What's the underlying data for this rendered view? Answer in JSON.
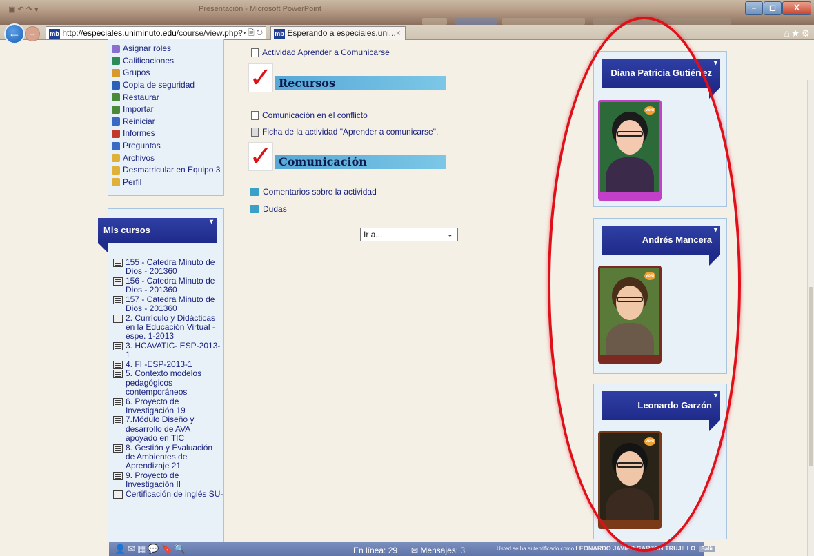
{
  "browser": {
    "window_title_faint": "Presentación - Microsoft PowerPoint",
    "address": "http://especiales.uniminuto.edu/course/view.php?",
    "address_domain": "especiales.uniminuto.edu",
    "address_prefix": "http://",
    "address_suffix": "/course/view.php?",
    "address_icons": "⌕ ▾ 🖹 ↻",
    "tab_title": "Esperando a especiales.uni...",
    "tab_close": "×",
    "back_glyph": "←",
    "forward_glyph": "→",
    "favicon_text": "mb",
    "right_icons": "⌂★⚙",
    "window_buttons": {
      "minimize": "–",
      "maximize": "◻",
      "close": "X"
    }
  },
  "admin_menu": {
    "items": [
      {
        "label": "Asignar roles",
        "icon": "roles-icon",
        "color": "#8a6fd0"
      },
      {
        "label": "Calificaciones",
        "icon": "grades-icon",
        "color": "#2e8b57"
      },
      {
        "label": "Grupos",
        "icon": "groups-icon",
        "color": "#d99a2b"
      },
      {
        "label": "Copia de seguridad",
        "icon": "backup-icon",
        "color": "#2a60b8"
      },
      {
        "label": "Restaurar",
        "icon": "restore-icon",
        "color": "#4a8b3a"
      },
      {
        "label": "Importar",
        "icon": "import-icon",
        "color": "#4a8b3a"
      },
      {
        "label": "Reiniciar",
        "icon": "reset-icon",
        "color": "#3a6ac2"
      },
      {
        "label": "Informes",
        "icon": "reports-icon",
        "color": "#c0392b"
      },
      {
        "label": "Preguntas",
        "icon": "questions-icon",
        "color": "#3a6ac2"
      },
      {
        "label": "Archivos",
        "icon": "folder-icon",
        "color": "#e0b13a"
      },
      {
        "label": "Desmatricular en Equipo 3",
        "icon": "unenrol-icon",
        "color": "#e0b13a"
      },
      {
        "label": "Perfil",
        "icon": "profile-icon",
        "color": "#e0b13a"
      }
    ]
  },
  "my_courses": {
    "title": "Mis cursos",
    "items": [
      "155 - Catedra Minuto de Dios - 201360",
      "156 - Catedra Minuto de Dios - 201360",
      "157 - Catedra Minuto de Dios - 201360",
      "2. Currículo y Didácticas en la Educación Virtual - espe. 1-2013",
      "3. HCAVATIC- ESP-2013-1",
      "4. FI -ESP-2013-1",
      "5. Contexto modelos pedagógicos contemporáneos",
      "6. Proyecto de Investigación 19",
      "7.Módulo Diseño y desarrollo de AVA apoyado en TIC",
      "8. Gestión y Evaluación de Ambientes de Aprendizaje 21",
      "9. Proyecto de Investigación II",
      "Certificación de inglés SU-"
    ]
  },
  "center": {
    "top_link": "Actividad Aprender a Comunicarse",
    "check_glyph": "✓",
    "recursos": {
      "title": "Recursos",
      "links": [
        "Comunicación en el conflicto",
        "Ficha de la actividad \"Aprender a comunicarse\"."
      ]
    },
    "comunicacion": {
      "title": "Comunicación",
      "links": [
        "Comentarios sobre la actividad",
        "Dudas"
      ]
    },
    "jump_select": {
      "value": "Ir a...",
      "arrow": "⌄"
    }
  },
  "users": [
    {
      "name": "Diana Patricia Gutiérrez",
      "frame_color": "#c23fc8",
      "bg_color": "#2d6a3a",
      "hair_color": "#1b1b1b",
      "skin_color": "#f4c9b0"
    },
    {
      "name": "Andrés Mancera",
      "frame_color": "#7a2a20",
      "bg_color": "#5a7a3a",
      "hair_color": "#4a2e1a",
      "skin_color": "#f0c8a8"
    },
    {
      "name": "Leonardo Garzón",
      "frame_color": "#7a3a18",
      "bg_color": "#2a2418",
      "hair_color": "#141414",
      "skin_color": "#efc7a8"
    }
  ],
  "avatar_badge": "voki",
  "caret_glyph": "▾",
  "bottom_bar": {
    "icons": "👤✉▦💬🔖🔍",
    "online": "En línea: 29",
    "messages": "Mensajes: 3",
    "messages_icon": "✉",
    "auth_text": "Usted se ha autentificado como",
    "user": "LEONARDO JAVIER GARZON TRUJILLO",
    "logout": "Salir"
  }
}
